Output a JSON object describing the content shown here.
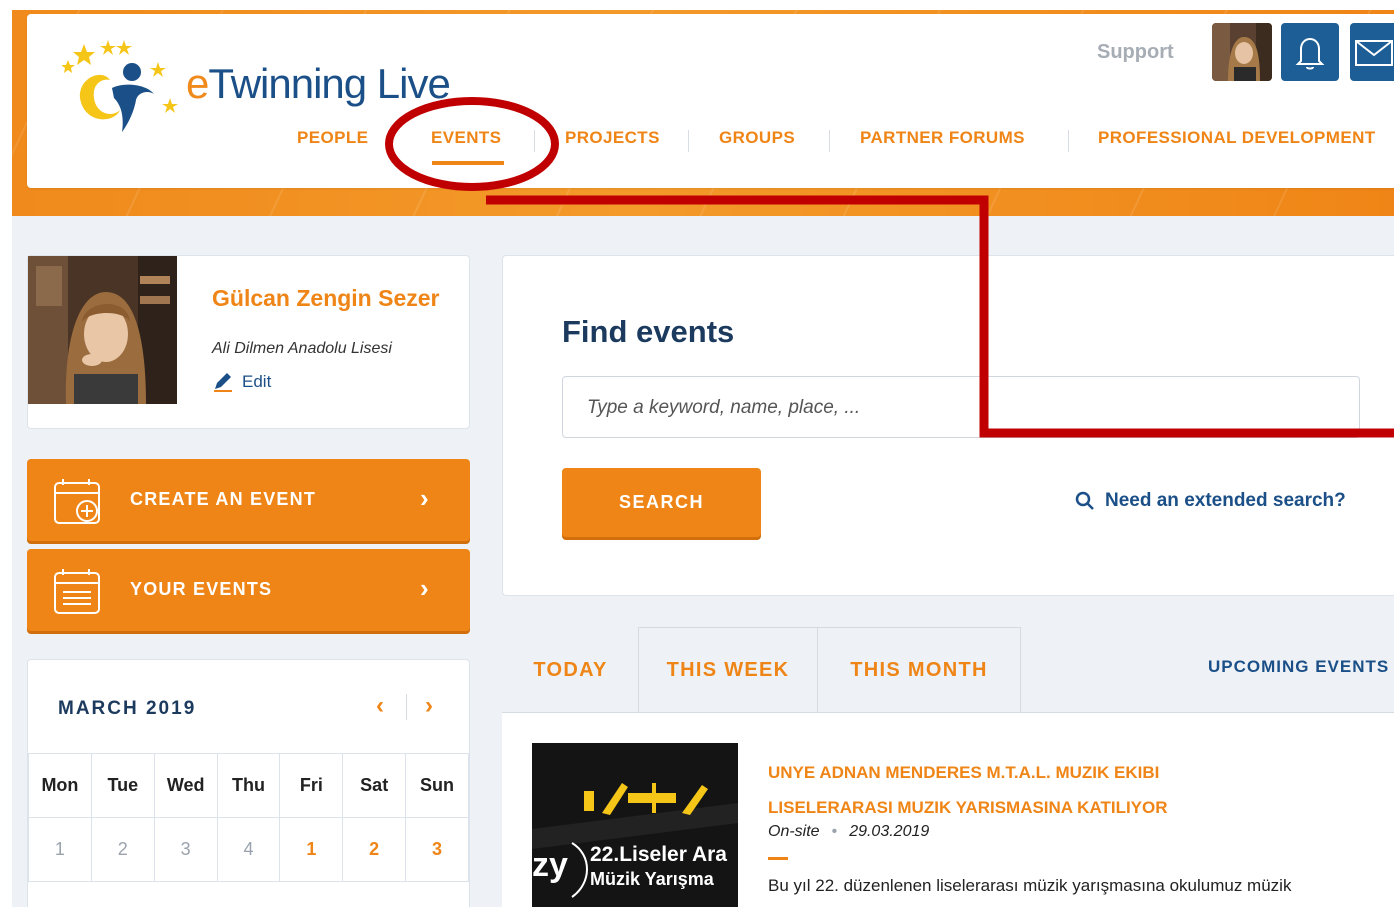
{
  "header": {
    "logo_text_e": "e",
    "logo_text_rest": "Twinning Live",
    "support_label": "Support"
  },
  "nav": {
    "items": [
      "PEOPLE",
      "EVENTS",
      "PROJECTS",
      "GROUPS",
      "PARTNER FORUMS",
      "PROFESSIONAL DEVELOPMENT"
    ],
    "active": "EVENTS"
  },
  "profile": {
    "name": "Gülcan Zengin Sezer",
    "school": "Ali Dilmen Anadolu Lisesi",
    "edit_label": "Edit"
  },
  "actions": {
    "create_label": "CREATE AN EVENT",
    "your_events_label": "YOUR EVENTS"
  },
  "calendar": {
    "title": "MARCH 2019",
    "days": [
      "Mon",
      "Tue",
      "Wed",
      "Thu",
      "Fri",
      "Sat",
      "Sun"
    ],
    "first_row": [
      "1",
      "2",
      "3",
      "4",
      "1",
      "2",
      "3"
    ]
  },
  "find": {
    "title": "Find events",
    "placeholder": "Type a keyword, name, place, ...",
    "search_label": "SEARCH",
    "extended_label": "Need an extended search?"
  },
  "tabs": {
    "today": "TODAY",
    "week": "THIS WEEK",
    "month": "THIS MONTH",
    "upcoming": "UPCOMING EVENTS"
  },
  "event": {
    "title": "UNYE ADNAN MENDERES M.T.A.L. MUZIK EKIBI LISELERARASI MUZIK YARISMASINA KATILIYOR",
    "type": "On-site",
    "date": "29.03.2019",
    "description": "Bu yıl 22. düzenlenen liselerarası müzik yarışmasına okulumuz müzik",
    "image_line1": "22.Liseler Ara",
    "image_line2": "Müzik Yarışma",
    "image_prefix": "zy"
  },
  "colors": {
    "accent": "#ef8516",
    "navy": "#1b4f87",
    "annotation_red": "#c00000"
  }
}
